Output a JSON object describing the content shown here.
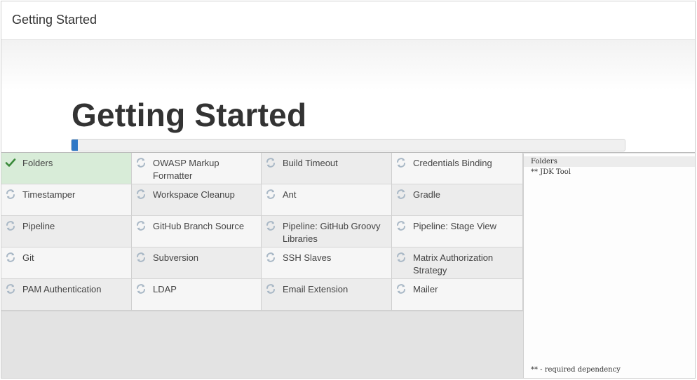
{
  "header": {
    "title": "Getting Started"
  },
  "hero": {
    "title": "Getting Started",
    "progress": 0.012
  },
  "plugins": [
    {
      "label": "Folders",
      "status": "done",
      "icon": "check-icon"
    },
    {
      "label": "OWASP Markup Formatter",
      "status": "pending",
      "icon": "refresh-icon"
    },
    {
      "label": "Build Timeout",
      "status": "pending",
      "icon": "refresh-icon"
    },
    {
      "label": "Credentials Binding",
      "status": "pending",
      "icon": "refresh-icon"
    },
    {
      "label": "Timestamper",
      "status": "pending",
      "icon": "refresh-icon"
    },
    {
      "label": "Workspace Cleanup",
      "status": "pending",
      "icon": "refresh-icon"
    },
    {
      "label": "Ant",
      "status": "pending",
      "icon": "refresh-icon"
    },
    {
      "label": "Gradle",
      "status": "pending",
      "icon": "refresh-icon"
    },
    {
      "label": "Pipeline",
      "status": "installing",
      "icon": "refresh-icon"
    },
    {
      "label": "GitHub Branch Source",
      "status": "pending",
      "icon": "refresh-icon"
    },
    {
      "label": "Pipeline: GitHub Groovy Libraries",
      "status": "installing",
      "icon": "refresh-icon"
    },
    {
      "label": "Pipeline: Stage View",
      "status": "pending",
      "icon": "refresh-icon"
    },
    {
      "label": "Git",
      "status": "pending",
      "icon": "refresh-icon"
    },
    {
      "label": "Subversion",
      "status": "pending",
      "icon": "refresh-icon"
    },
    {
      "label": "SSH Slaves",
      "status": "pending",
      "icon": "refresh-icon"
    },
    {
      "label": "Matrix Authorization Strategy",
      "status": "pending",
      "icon": "refresh-icon"
    },
    {
      "label": "PAM Authentication",
      "status": "pending",
      "icon": "refresh-icon"
    },
    {
      "label": "LDAP",
      "status": "pending",
      "icon": "refresh-icon"
    },
    {
      "label": "Email Extension",
      "status": "pending",
      "icon": "refresh-icon"
    },
    {
      "label": "Mailer",
      "status": "pending",
      "icon": "refresh-icon"
    }
  ],
  "log": {
    "lines": [
      "Folders",
      "** JDK Tool"
    ],
    "footer": "** - required dependency"
  },
  "colors": {
    "progress": "#2f78c6",
    "done_bg": "#d8ecd8",
    "check": "#3a8a3a",
    "refresh": "#a9b8c6"
  }
}
